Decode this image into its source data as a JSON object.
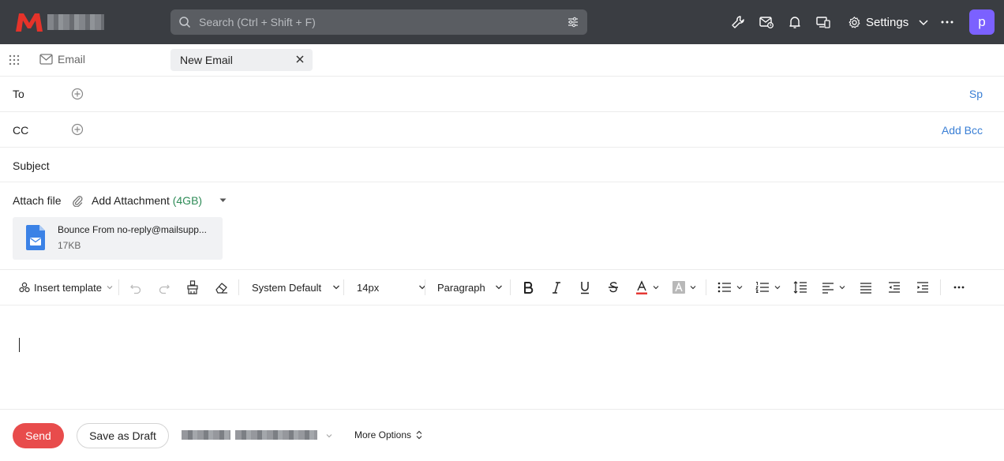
{
  "topbar": {
    "search_placeholder": "Search (Ctrl + Shift + F)",
    "settings_label": "Settings",
    "avatar_letter": "p"
  },
  "tabs": {
    "email_label": "Email",
    "new_email_label": "New Email"
  },
  "compose": {
    "to_label": "To",
    "to_right_link": "Sp",
    "cc_label": "CC",
    "cc_right_link": "Add Bcc",
    "subject_label": "Subject",
    "attach_label": "Attach file",
    "add_attachment_label": "Add Attachment",
    "attachment_limit": "(4GB)",
    "attachment": {
      "name": "Bounce From no-reply@mailsupp...",
      "size": "17KB"
    }
  },
  "toolbar": {
    "insert_template": "Insert template",
    "font_family": "System Default",
    "font_size": "14px",
    "block_format": "Paragraph"
  },
  "footer": {
    "send_label": "Send",
    "draft_label": "Save as Draft",
    "more_options_label": "More Options"
  },
  "colors": {
    "topbar_bg": "#3a3d42",
    "accent_link": "#3a7fd5",
    "send_button": "#e84c4c",
    "avatar_bg": "#7b61ff",
    "attachment_size": "#2e8b57"
  }
}
